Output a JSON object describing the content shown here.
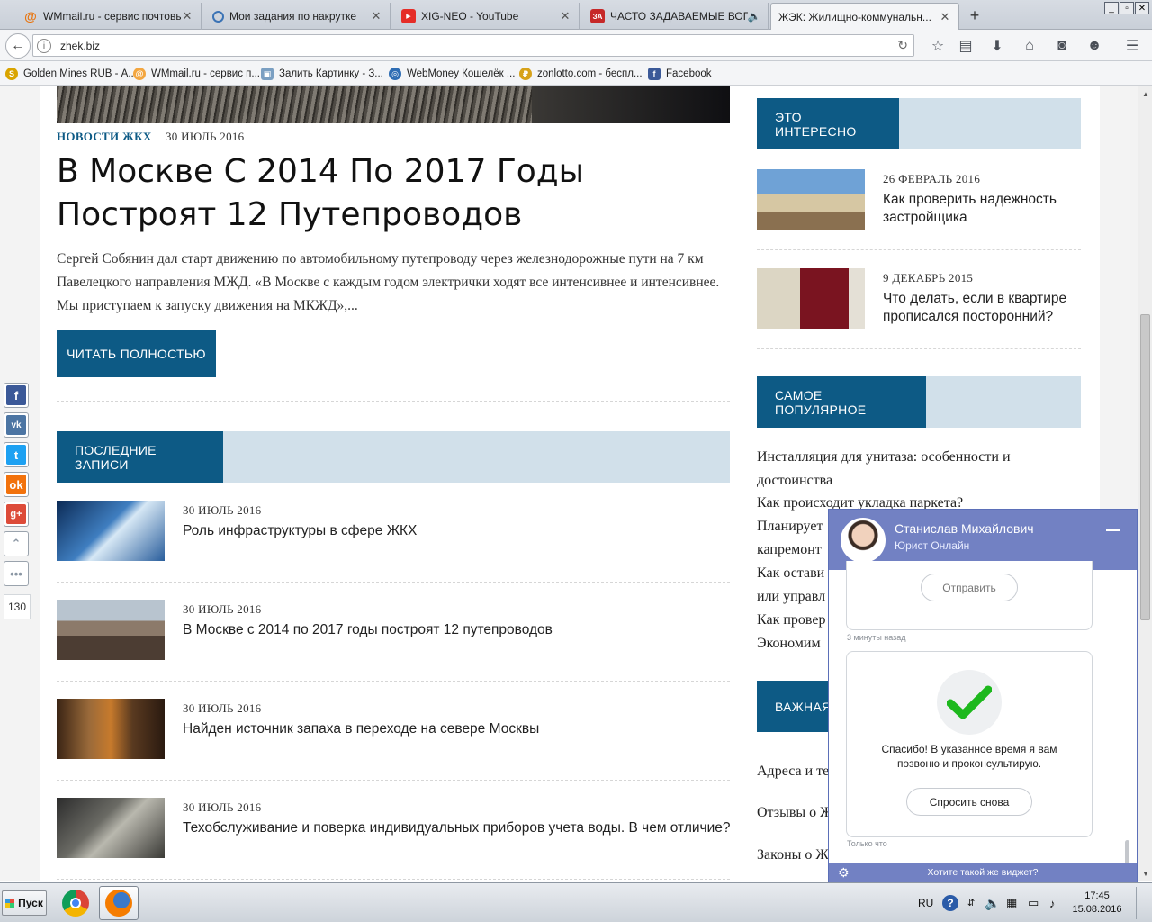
{
  "browser": {
    "tabs": [
      {
        "title": "WMmail.ru - сервис почтовы...",
        "icon": "wmmail-icon"
      },
      {
        "title": "Мои задания по накрутке",
        "icon": "spiral-icon"
      },
      {
        "title": "XIG-NEO - YouTube",
        "icon": "youtube-icon"
      },
      {
        "title": "ЧАСТО ЗАДАВАЕМЫЕ ВОПР...",
        "icon": "za-icon"
      },
      {
        "title": "ЖЭК: Жилищно-коммунальн...",
        "icon": "zhek-icon"
      }
    ],
    "url": "zhek.biz",
    "bookmarks": [
      {
        "label": "Golden Mines RUB - А..."
      },
      {
        "label": "WMmail.ru - сервис п..."
      },
      {
        "label": "Залить Картинку - З..."
      },
      {
        "label": "WebMoney Кошелёк ..."
      },
      {
        "label": "zonlotto.com - беспл..."
      },
      {
        "label": "Facebook"
      }
    ]
  },
  "article": {
    "category": "НОВОСТИ ЖКХ",
    "date": "30 ИЮЛЬ 2016",
    "title": "В Москве С 2014 По 2017 Годы Построят 12 Путепроводов",
    "excerpt": "Сергей Собянин дал старт движению по автомобильному путепроводу через железнодорожные пути на 7 км Павелецкого направления МЖД. «В Москве с каждым годом электрички ходят все интенсивнее и интенсивнее. Мы приступаем к запуску движения на МКЖД»,...",
    "read_more": "ЧИТАТЬ ПОЛНОСТЬЮ"
  },
  "latest": {
    "heading": "ПОСЛЕДНИЕ ЗАПИСИ",
    "posts": [
      {
        "date": "30 ИЮЛЬ 2016",
        "title": "Роль инфраструктуры в сфере ЖКХ"
      },
      {
        "date": "30 ИЮЛЬ 2016",
        "title": "В Москве с 2014 по 2017 годы построят 12 путепроводов"
      },
      {
        "date": "30 ИЮЛЬ 2016",
        "title": "Найден источник запаха в переходе на севере Москвы"
      },
      {
        "date": "30 ИЮЛЬ 2016",
        "title": "Техобслуживание и поверка индивидуальных приборов учета воды. В чем отличие?"
      }
    ]
  },
  "sidebar": {
    "interesting": {
      "heading": "ЭТО ИНТЕРЕСНО",
      "items": [
        {
          "date": "26 ФЕВРАЛЬ 2016",
          "title": "Как проверить надежность застройщика"
        },
        {
          "date": "9 ДЕКАБРЬ 2015",
          "title": "Что делать, если в квартире прописался посторонний?"
        }
      ]
    },
    "popular": {
      "heading": "САМОЕ ПОПУЛЯРНОЕ",
      "links": [
        "Инсталляция для унитаза: особенности и достоинства",
        "Как происходит укладка паркета?",
        "Планирует",
        "капремонт",
        "Как остави",
        "или управл",
        "Как провер",
        "Экономим"
      ]
    },
    "important": {
      "heading": "ВАЖНАЯ",
      "links": [
        "Адреса и те",
        "Отзывы о Ж",
        "Законы о Ж"
      ]
    }
  },
  "social": {
    "count": "130"
  },
  "chat": {
    "agent_name": "Станислав Михайлович",
    "agent_role": "Юрист Онлайн",
    "send_label": "Отправить",
    "meta_1": "3 минуты назад",
    "thanks_text": "Спасибо! В указанное время я вам позвоню и проконсультирую.",
    "ask_again_label": "Спросить снова",
    "meta_2": "Только что",
    "footer_text": "Хотите такой же виджет?"
  },
  "taskbar": {
    "start_label": "Пуск",
    "lang": "RU",
    "time": "17:45",
    "date": "15.08.2016"
  }
}
